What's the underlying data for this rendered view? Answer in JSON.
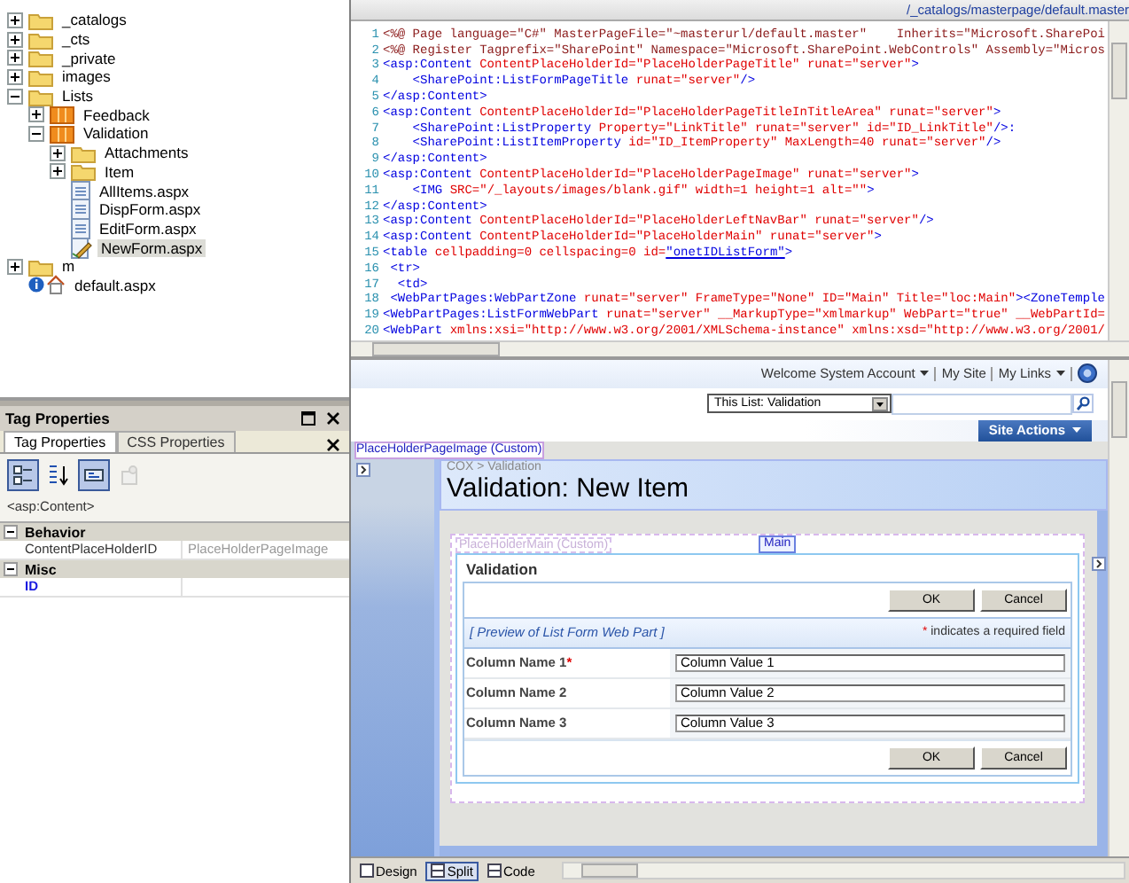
{
  "tree": [
    {
      "label": "_catalogs",
      "kind": "folder",
      "expanded": false,
      "selected": false
    },
    {
      "label": "_cts",
      "kind": "folder",
      "expanded": false,
      "selected": false
    },
    {
      "label": "_private",
      "kind": "folder",
      "expanded": false,
      "selected": false
    },
    {
      "label": "images",
      "kind": "folder",
      "expanded": false,
      "selected": false
    },
    {
      "label": "Lists",
      "kind": "folder",
      "expanded": true,
      "selected": false,
      "children": [
        {
          "label": "Feedback",
          "kind": "list",
          "expanded": false,
          "selected": false
        },
        {
          "label": "Validation",
          "kind": "list",
          "expanded": true,
          "selected": false,
          "children": [
            {
              "label": "Attachments",
              "kind": "folder",
              "expanded": false,
              "selected": false
            },
            {
              "label": "Item",
              "kind": "folder",
              "expanded": false,
              "selected": false
            },
            {
              "label": "AllItems.aspx",
              "kind": "page",
              "selected": false
            },
            {
              "label": "DispForm.aspx",
              "kind": "page",
              "selected": false
            },
            {
              "label": "EditForm.aspx",
              "kind": "page",
              "selected": false
            },
            {
              "label": "NewForm.aspx",
              "kind": "form",
              "selected": true
            }
          ]
        }
      ]
    },
    {
      "label": "m",
      "kind": "folder",
      "expanded": false,
      "selected": false
    },
    {
      "label": "default.aspx",
      "kind": "home",
      "selected": false
    }
  ],
  "tag_panel": {
    "title": "Tag Properties",
    "tabs": [
      {
        "label": "Tag Properties",
        "selected": true
      },
      {
        "label": "CSS Properties",
        "selected": false
      }
    ],
    "toolbar": [
      {
        "kind": "categorized",
        "pressed": true,
        "disabled": false
      },
      {
        "kind": "sort",
        "pressed": false,
        "disabled": false
      },
      {
        "kind": "show-set",
        "pressed": true,
        "disabled": false
      },
      {
        "kind": "properties",
        "pressed": false,
        "disabled": true
      }
    ],
    "tag": "<asp:Content>",
    "categories": [
      {
        "name": "Behavior",
        "expanded": true,
        "properties": [
          {
            "name": "ContentPlaceHolderID",
            "value": "PlaceHolderPageImage",
            "readonly": true
          }
        ]
      },
      {
        "name": "Misc",
        "expanded": true,
        "properties": [
          {
            "name": "ID",
            "readonly": false
          }
        ]
      }
    ]
  },
  "code_path": "/_catalogs/masterpage/default.master",
  "code_lines": [
    {
      "number": "1",
      "segments": [
        {
          "kind": "directive",
          "text": "<%@ Page language=\"C#\" MasterPageFile=\"~masterurl/default.master\"    Inherits=\"Microsoft.SharePoi"
        }
      ]
    },
    {
      "number": "2",
      "segments": [
        {
          "kind": "directive",
          "text": "<%@ Register Tagprefix=\"SharePoint\" Namespace=\"Microsoft.SharePoint.WebControls\" Assembly=\"Micros"
        }
      ]
    },
    {
      "number": "3",
      "segments": [
        {
          "kind": "tag",
          "text": "<asp:Content "
        },
        {
          "kind": "attribute",
          "text": "ContentPlaceHolderId=\"PlaceHolderPageTitle\" runat=\"server\""
        },
        {
          "kind": "tag",
          "text": ">"
        }
      ]
    },
    {
      "number": "4",
      "segments": [
        {
          "kind": "tag",
          "text": "    <SharePoint:ListFormPageTitle "
        },
        {
          "kind": "attribute",
          "text": "runat=\"server\""
        },
        {
          "kind": "tag",
          "text": "/>"
        }
      ]
    },
    {
      "number": "5",
      "segments": [
        {
          "kind": "tag",
          "text": "</asp:Content>"
        }
      ]
    },
    {
      "number": "6",
      "segments": [
        {
          "kind": "tag",
          "text": "<asp:Content "
        },
        {
          "kind": "attribute",
          "text": "ContentPlaceHolderId=\"PlaceHolderPageTitleInTitleArea\" runat=\"server\""
        },
        {
          "kind": "tag",
          "text": ">"
        }
      ]
    },
    {
      "number": "7",
      "segments": [
        {
          "kind": "tag",
          "text": "    <SharePoint:ListProperty "
        },
        {
          "kind": "attribute",
          "text": "Property=\"LinkTitle\" runat=\"server\" id=\"ID_LinkTitle\""
        },
        {
          "kind": "tag",
          "text": "/>:"
        }
      ]
    },
    {
      "number": "8",
      "segments": [
        {
          "kind": "tag",
          "text": "    <SharePoint:ListItemProperty "
        },
        {
          "kind": "attribute",
          "text": "id=\"ID_ItemProperty\" MaxLength=40 runat=\"server\""
        },
        {
          "kind": "tag",
          "text": "/>"
        }
      ]
    },
    {
      "number": "9",
      "segments": [
        {
          "kind": "tag",
          "text": "</asp:Content>"
        }
      ]
    },
    {
      "number": "10",
      "segments": [
        {
          "kind": "tag",
          "text": "<asp:Content "
        },
        {
          "kind": "attribute",
          "text": "ContentPlaceHolderId=\"PlaceHolderPageImage\" runat=\"server\""
        },
        {
          "kind": "tag",
          "text": ">"
        }
      ]
    },
    {
      "number": "11",
      "segments": [
        {
          "kind": "tag",
          "text": "    <IMG "
        },
        {
          "kind": "attribute",
          "text": "SRC=\"/_layouts/images/blank.gif\" width=1 height=1 alt=\"\""
        },
        {
          "kind": "tag",
          "text": ">"
        }
      ]
    },
    {
      "number": "12",
      "segments": [
        {
          "kind": "tag",
          "text": "</asp:Content>"
        }
      ]
    },
    {
      "number": "13",
      "segments": [
        {
          "kind": "tag",
          "text": "<asp:Content "
        },
        {
          "kind": "attribute",
          "text": "ContentPlaceHolderId=\"PlaceHolderLeftNavBar\" runat=\"server\""
        },
        {
          "kind": "tag",
          "text": "/>"
        }
      ]
    },
    {
      "number": "14",
      "segments": [
        {
          "kind": "tag",
          "text": "<asp:Content "
        },
        {
          "kind": "attribute",
          "text": "ContentPlaceHolderId=\"PlaceHolderMain\" runat=\"server\""
        },
        {
          "kind": "tag",
          "text": ">"
        }
      ]
    },
    {
      "number": "15",
      "segments": [
        {
          "kind": "tag",
          "text": "<table "
        },
        {
          "kind": "attribute",
          "text": "cellpadding=0 cellspacing=0 id="
        },
        {
          "kind": "link",
          "text": "\"onetIDListForm\""
        },
        {
          "kind": "tag",
          "text": ">"
        }
      ]
    },
    {
      "number": "16",
      "segments": [
        {
          "kind": "tag",
          "text": " <tr>"
        }
      ]
    },
    {
      "number": "17",
      "segments": [
        {
          "kind": "tag",
          "text": "  <td>"
        }
      ]
    },
    {
      "number": "18",
      "segments": [
        {
          "kind": "tag",
          "text": " <WebPartPages:WebPartZone "
        },
        {
          "kind": "attribute",
          "text": "runat=\"server\" FrameType=\"None\" ID=\"Main\" Title=\"loc:Main\""
        },
        {
          "kind": "tag",
          "text": "><ZoneTemple"
        }
      ]
    },
    {
      "number": "19",
      "segments": [
        {
          "kind": "tag",
          "text": "<WebPartPages:ListFormWebPart "
        },
        {
          "kind": "attribute",
          "text": "runat=\"server\" __MarkupType=\"xmlmarkup\" WebPart=\"true\" __WebPartId="
        }
      ]
    },
    {
      "number": "20",
      "segments": [
        {
          "kind": "tag",
          "text": "<WebPart "
        },
        {
          "kind": "attribute",
          "text": "xmlns:xsi=\"http://www.w3.org/2001/XMLSchema-instance\" xmlns:xsd=\"http://www.w3.org/2001/"
        }
      ]
    }
  ],
  "design": {
    "top_links": [
      {
        "label": "Welcome System Account",
        "dropdown": true
      },
      {
        "label": "My Site",
        "dropdown": false
      },
      {
        "label": "My Links",
        "dropdown": true
      }
    ],
    "scope": "This List: Validation",
    "site_actions": "Site Actions",
    "page_image_label": "PlaceHolderPageImage (Custom)",
    "breadcrumb": "COX > Validation",
    "page_title": "Validation: New Item",
    "main_label": "PlaceHolderMain (Custom)",
    "zone_label": "Main",
    "webpart": {
      "title": "Validation",
      "buttons": [
        "OK",
        "Cancel"
      ],
      "preview": "[ Preview of List Form Web Part ]",
      "note_mark": "*",
      "note": "indicates a required field",
      "fields": [
        {
          "label": "Column Name 1",
          "mark": "*",
          "value": "Column Value 1"
        },
        {
          "label": "Column Name 2",
          "value": "Column Value 2"
        },
        {
          "label": "Column Name 3",
          "value": "Column Value 3"
        }
      ],
      "bottom_buttons": [
        "OK",
        "Cancel"
      ]
    }
  },
  "view_tabs": [
    {
      "label": "Design",
      "selected": false
    },
    {
      "label": "Split",
      "selected": true
    },
    {
      "label": "Code",
      "selected": false
    }
  ]
}
